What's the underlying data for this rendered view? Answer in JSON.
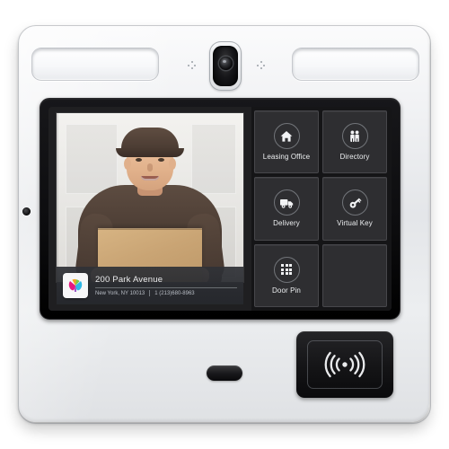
{
  "device": {
    "name": "video-intercom-door-station",
    "hardware": {
      "camera": "camera-lens",
      "speaker_left": "speaker-grille",
      "speaker_right": "speaker-grille",
      "mic_left": "microphone-port",
      "mic_right": "microphone-port",
      "side_sensor": "side-sensor",
      "pill_sensor": "proximity-sensor",
      "rfid_reader": "rfid-nfc-reader",
      "rfid_icon": "contactless-wave-icon"
    }
  },
  "screen": {
    "video": {
      "name": "live-video-feed",
      "subject": "delivery-person-with-package"
    },
    "address_overlay": {
      "logo": "property-logo",
      "street": "200 Park Avenue",
      "city_state_zip": "New York, NY 10013",
      "phone": "1 (213)680-8963"
    },
    "tiles": [
      {
        "label": "Leasing Office",
        "icon": "home-icon",
        "empty": false
      },
      {
        "label": "Directory",
        "icon": "people-icon",
        "empty": false
      },
      {
        "label": "Delivery",
        "icon": "truck-icon",
        "empty": false
      },
      {
        "label": "Virtual Key",
        "icon": "key-icon",
        "empty": false
      },
      {
        "label": "Door Pin",
        "icon": "keypad-grid-icon",
        "empty": false
      },
      {
        "label": "",
        "icon": "",
        "empty": true
      }
    ]
  },
  "colors": {
    "chassis": "#eceef0",
    "bezel": "#0c0c0e",
    "screen_bg": "#151517",
    "tile_bg": "#2e2e31",
    "tile_border": "#47474b",
    "tile_text": "#eceef0",
    "overlay_bg": "#303237",
    "overlay_title": "#e9eaec",
    "overlay_sub": "#b9bec6"
  }
}
